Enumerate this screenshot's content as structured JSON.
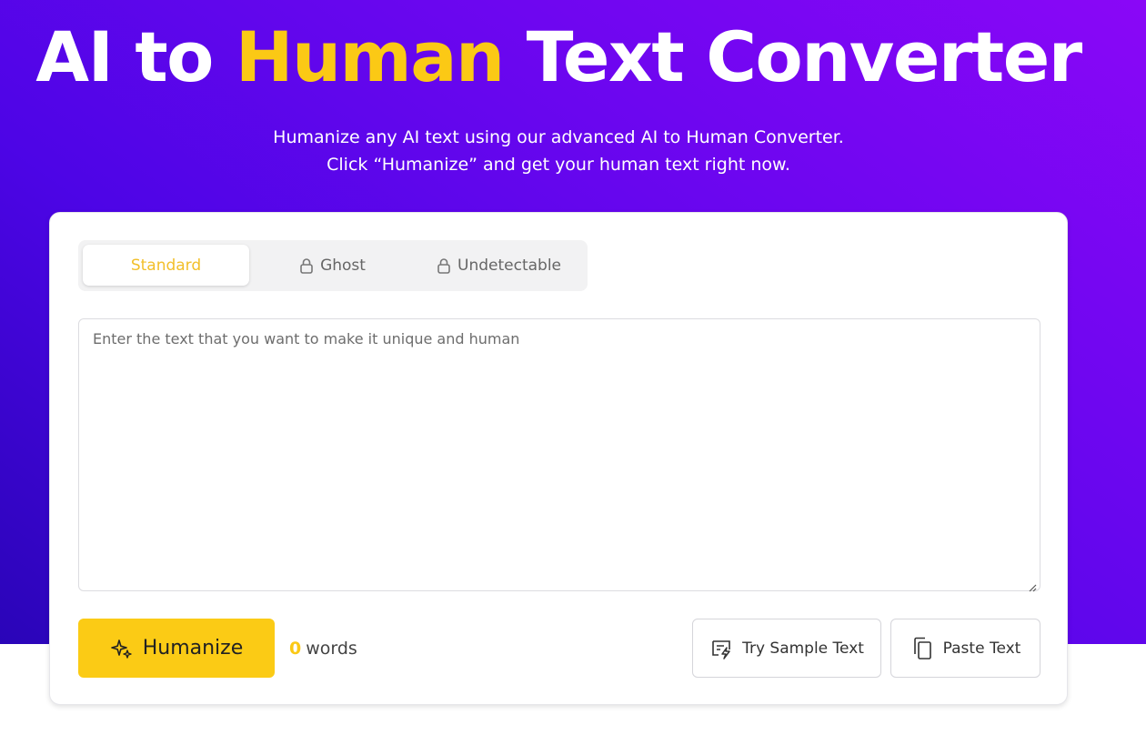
{
  "hero": {
    "title_part1": "AI to ",
    "title_highlight": "Human",
    "title_part2": " Text Converter",
    "subtitle_line1": "Humanize any AI text using our advanced AI to Human Converter.",
    "subtitle_line2": "Click “Humanize” and get your human text right now."
  },
  "tabs": [
    {
      "label": "Standard",
      "locked": false,
      "active": true
    },
    {
      "label": "Ghost",
      "locked": true,
      "active": false,
      "icon": "lock-icon"
    },
    {
      "label": "Undetectable",
      "locked": true,
      "active": false,
      "icon": "lock-icon"
    }
  ],
  "editor": {
    "placeholder": "Enter the text that you want to make it unique and human",
    "value": ""
  },
  "actions": {
    "humanize_label": "Humanize",
    "humanize_icon": "sparkles-icon",
    "word_count": "0",
    "word_label": "words",
    "sample_label": "Try Sample Text",
    "sample_icon": "sample-text-icon",
    "paste_label": "Paste Text",
    "paste_icon": "copy-icon"
  },
  "colors": {
    "accent_yellow": "#fbc915",
    "gradient_start": "#2a05b8",
    "gradient_end": "#8a07f7"
  }
}
